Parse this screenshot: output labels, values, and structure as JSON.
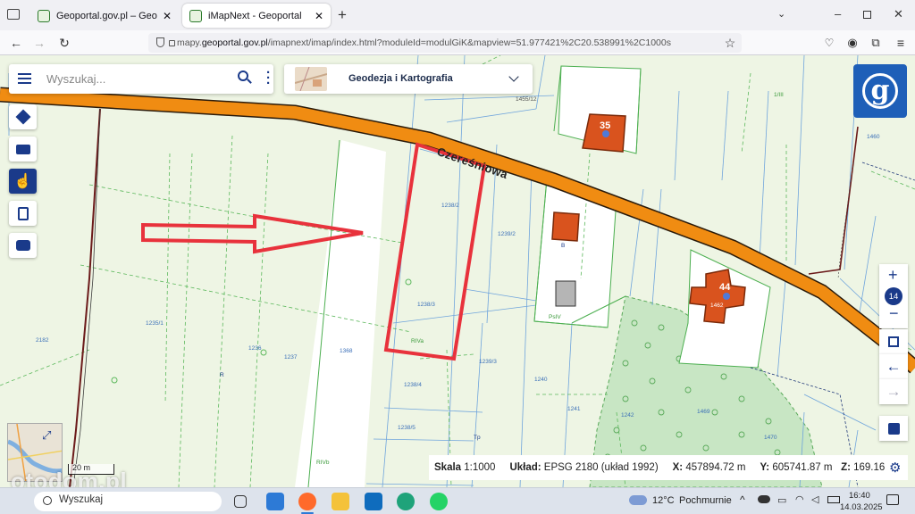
{
  "browser": {
    "tabs": [
      {
        "title": "Geoportal.gov.pl – Geoportal Inf"
      },
      {
        "title": "iMapNext - Geoportal"
      }
    ],
    "url_prefix": "mapy.",
    "url_domain": "geoportal.gov.pl",
    "url_suffix": "/imapnext/imap/index.html?moduleId=modulGiK&mapview=51.977421%2C20.538991%2C1000s"
  },
  "app": {
    "search_placeholder": "Wyszukaj...",
    "layer_title": "Geodezja i Kartografia",
    "zoom_level": "14"
  },
  "map": {
    "street_name": "Czereśniowa",
    "building_numbers": [
      "35",
      "44"
    ],
    "parcel_labels": [
      "1455/12",
      "1238/2",
      "1239/2",
      "1238/3",
      "RIVa",
      "1239/3",
      "1238/4",
      "1238/5",
      "Tp",
      "RIVb",
      "1240",
      "1241",
      "1235/1",
      "2182",
      "1236",
      "1237",
      "1368",
      "R",
      "PsIV",
      "B",
      "1460",
      "1/III",
      "1462",
      "1470",
      "1469",
      "1242"
    ],
    "scale_bar": "20 m"
  },
  "status": {
    "scale_label": "Skala",
    "scale_value": "1:1000",
    "crs_label": "Układ:",
    "crs_value": "EPSG 2180 (układ 1992)",
    "x_label": "X:",
    "x_value": "457894.72 m",
    "y_label": "Y:",
    "y_value": "605741.87 m",
    "z_label": "Z:",
    "z_value": "169.16"
  },
  "taskbar": {
    "search_placeholder": "Wyszukaj",
    "weather_temp": "12°C",
    "weather_desc": "Pochmurnie",
    "time": "16:40",
    "date": "14.03.2025"
  },
  "watermark": "otodom.pl"
}
